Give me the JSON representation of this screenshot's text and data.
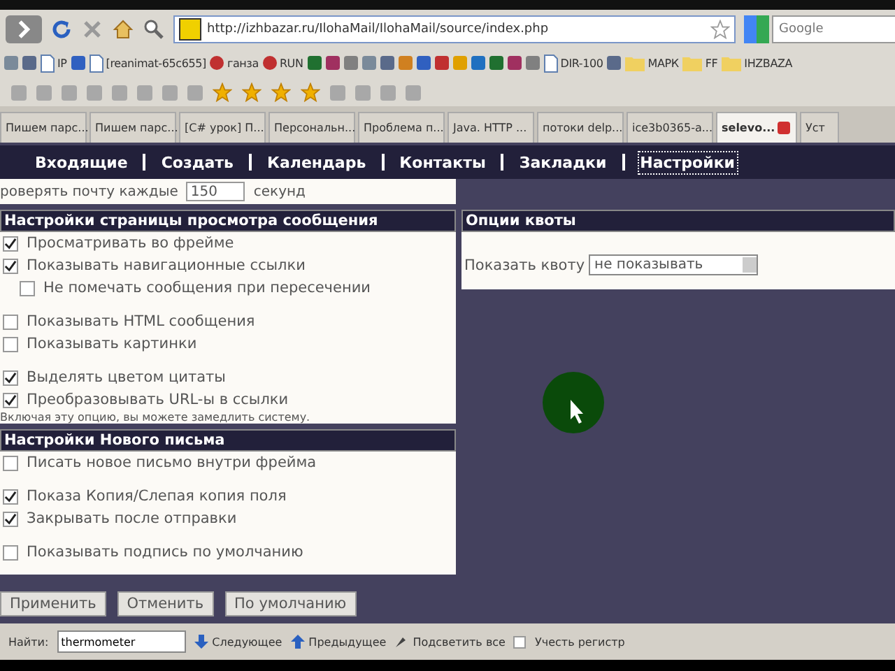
{
  "address_bar": {
    "url": "http://izhbazar.ru/IlohaMail/IlohaMail/source/index.php"
  },
  "search_field": {
    "placeholder": "Google"
  },
  "bookmarks": [
    {
      "kind": "icon"
    },
    {
      "kind": "icon"
    },
    {
      "kind": "page",
      "label": "IP"
    },
    {
      "kind": "icon"
    },
    {
      "kind": "page",
      "label": "[reanimat-65c655]"
    },
    {
      "kind": "link",
      "label": "ганза"
    },
    {
      "kind": "link",
      "label": "RUN"
    },
    {
      "kind": "icon"
    },
    {
      "kind": "icon"
    },
    {
      "kind": "icon"
    },
    {
      "kind": "icon"
    },
    {
      "kind": "icon"
    },
    {
      "kind": "icon"
    },
    {
      "kind": "icon"
    },
    {
      "kind": "icon"
    },
    {
      "kind": "icon"
    },
    {
      "kind": "icon"
    },
    {
      "kind": "icon"
    },
    {
      "kind": "icon"
    },
    {
      "kind": "icon"
    },
    {
      "kind": "page",
      "label": "DIR-100"
    },
    {
      "kind": "icon"
    },
    {
      "kind": "folder",
      "label": "МАРК"
    },
    {
      "kind": "folder",
      "label": "FF"
    },
    {
      "kind": "folder",
      "label": "IHZBAZA"
    }
  ],
  "tabs": [
    {
      "label": "Пишем парс...",
      "selected": false
    },
    {
      "label": "Пишем парс...",
      "selected": false
    },
    {
      "label": "[C# урок] П...",
      "selected": false
    },
    {
      "label": "Персональн...",
      "selected": false
    },
    {
      "label": "Проблема п...",
      "selected": false
    },
    {
      "label": "Java. HTTP ...",
      "selected": false
    },
    {
      "label": "потоки delp...",
      "selected": false
    },
    {
      "label": "ice3b0365-a...",
      "selected": false
    },
    {
      "label": "selevo...",
      "selected": true
    },
    {
      "label": "Уст",
      "selected": false
    }
  ],
  "page_nav": [
    {
      "label": "Входящие",
      "selected": false
    },
    {
      "label": "Создать",
      "selected": false
    },
    {
      "label": "Календарь",
      "selected": false
    },
    {
      "label": "Контакты",
      "selected": false
    },
    {
      "label": "Закладки",
      "selected": false
    },
    {
      "label": "Настройки",
      "selected": true
    }
  ],
  "check_mail": {
    "label": "роверять почту каждые",
    "value": "150",
    "unit": "секунд"
  },
  "view_settings": {
    "title": "Настройки страницы просмотра сообщения",
    "groups": [
      [
        {
          "label": "Просматривать во фрейме",
          "checked": true
        },
        {
          "label": "Показывать навигационные ссылки",
          "checked": true,
          "children": [
            {
              "label": "Не помечать сообщения при пересечении",
              "checked": false
            }
          ]
        }
      ],
      [
        {
          "label": "Показывать HTML сообщения",
          "checked": false
        },
        {
          "label": "Показывать картинки",
          "checked": false
        }
      ],
      [
        {
          "label": "Выделять цветом цитаты",
          "checked": true
        },
        {
          "label": "Преобразовывать URL-ы в ссылки",
          "checked": true
        }
      ]
    ],
    "note": "Включая эту опцию, вы можете замедлить систему."
  },
  "compose_settings": {
    "title": "Настройки Нового письма",
    "groups": [
      [
        {
          "label": "Писать новое письмо внутри фрейма",
          "checked": false
        }
      ],
      [
        {
          "label": "Показа Копия/Слепая копия поля",
          "checked": true
        },
        {
          "label": "Закрывать после отправки",
          "checked": true
        }
      ],
      [
        {
          "label": "Показывать подпись по умолчанию",
          "checked": false
        }
      ]
    ]
  },
  "quota": {
    "title": "Опции квоты",
    "label": "Показать квоту",
    "value": "не показывать"
  },
  "buttons": [
    "Применить",
    "Отменить",
    "По умолчанию"
  ],
  "find_bar": {
    "label": "Найти:",
    "value": "thermometer",
    "next": "Следующее",
    "previous": "Предыдущее",
    "highlight": "Подсветить все",
    "match_case": {
      "label": "Учесть регистр",
      "checked": false
    }
  }
}
